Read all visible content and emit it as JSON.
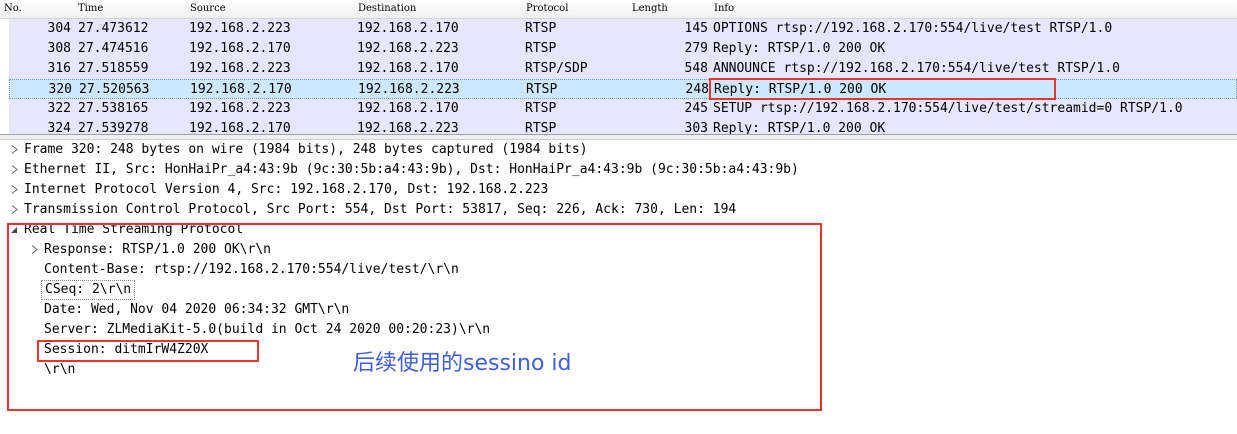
{
  "columns": {
    "no": "No.",
    "time": "Time",
    "source": "Source",
    "destination": "Destination",
    "protocol": "Protocol",
    "length": "Length",
    "info": "Info"
  },
  "packets": [
    {
      "no": "304",
      "time": "27.473612",
      "source": "192.168.2.223",
      "destination": "192.168.2.170",
      "protocol": "RTSP",
      "length": "145",
      "info": "OPTIONS rtsp://192.168.2.170:554/live/test RTSP/1.0"
    },
    {
      "no": "308",
      "time": "27.474516",
      "source": "192.168.2.170",
      "destination": "192.168.2.223",
      "protocol": "RTSP",
      "length": "279",
      "info": "Reply: RTSP/1.0 200 OK"
    },
    {
      "no": "316",
      "time": "27.518559",
      "source": "192.168.2.223",
      "destination": "192.168.2.170",
      "protocol": "RTSP/SDP",
      "length": "548",
      "info": "ANNOUNCE rtsp://192.168.2.170:554/live/test RTSP/1.0"
    },
    {
      "no": "320",
      "time": "27.520563",
      "source": "192.168.2.170",
      "destination": "192.168.2.223",
      "protocol": "RTSP",
      "length": "248",
      "info": "Reply: RTSP/1.0 200 OK"
    },
    {
      "no": "322",
      "time": "27.538165",
      "source": "192.168.2.223",
      "destination": "192.168.2.170",
      "protocol": "RTSP",
      "length": "245",
      "info": "SETUP rtsp://192.168.2.170:554/live/test/streamid=0 RTSP/1.0"
    },
    {
      "no": "324",
      "time": "27.539278",
      "source": "192.168.2.170",
      "destination": "192.168.2.223",
      "protocol": "RTSP",
      "length": "303",
      "info": "Reply: RTSP/1.0 200 OK"
    }
  ],
  "selected_index": 3,
  "details": {
    "frame": "Frame 320: 248 bytes on wire (1984 bits), 248 bytes captured (1984 bits)",
    "ethernet": "Ethernet II, Src: HonHaiPr_a4:43:9b (9c:30:5b:a4:43:9b), Dst: HonHaiPr_a4:43:9b (9c:30:5b:a4:43:9b)",
    "ip": "Internet Protocol Version 4, Src: 192.168.2.170, Dst: 192.168.2.223",
    "tcp": "Transmission Control Protocol, Src Port: 554, Dst Port: 53817, Seq: 226, Ack: 730, Len: 194",
    "rtsp": {
      "label": "Real Time Streaming Protocol",
      "response": "Response: RTSP/1.0 200 OK\\r\\n",
      "content_base": "Content-Base: rtsp://192.168.2.170:554/live/test/\\r\\n",
      "cseq": "CSeq: 2\\r\\n",
      "date": "Date: Wed, Nov 04 2020 06:34:32 GMT\\r\\n",
      "server": "Server: ZLMediaKit-5.0(build in Oct 24 2020 00:20:23)\\r\\n",
      "session": "Session: ditmIrW4Z20X",
      "crlf": "\\r\\n"
    }
  },
  "annotation": "后续使用的sessino id",
  "colors": {
    "row_bg": "#e7e6ff",
    "selected_bg": "#cbe8ff",
    "highlight": "#e8352f",
    "annotation": "#3f5ee0"
  }
}
